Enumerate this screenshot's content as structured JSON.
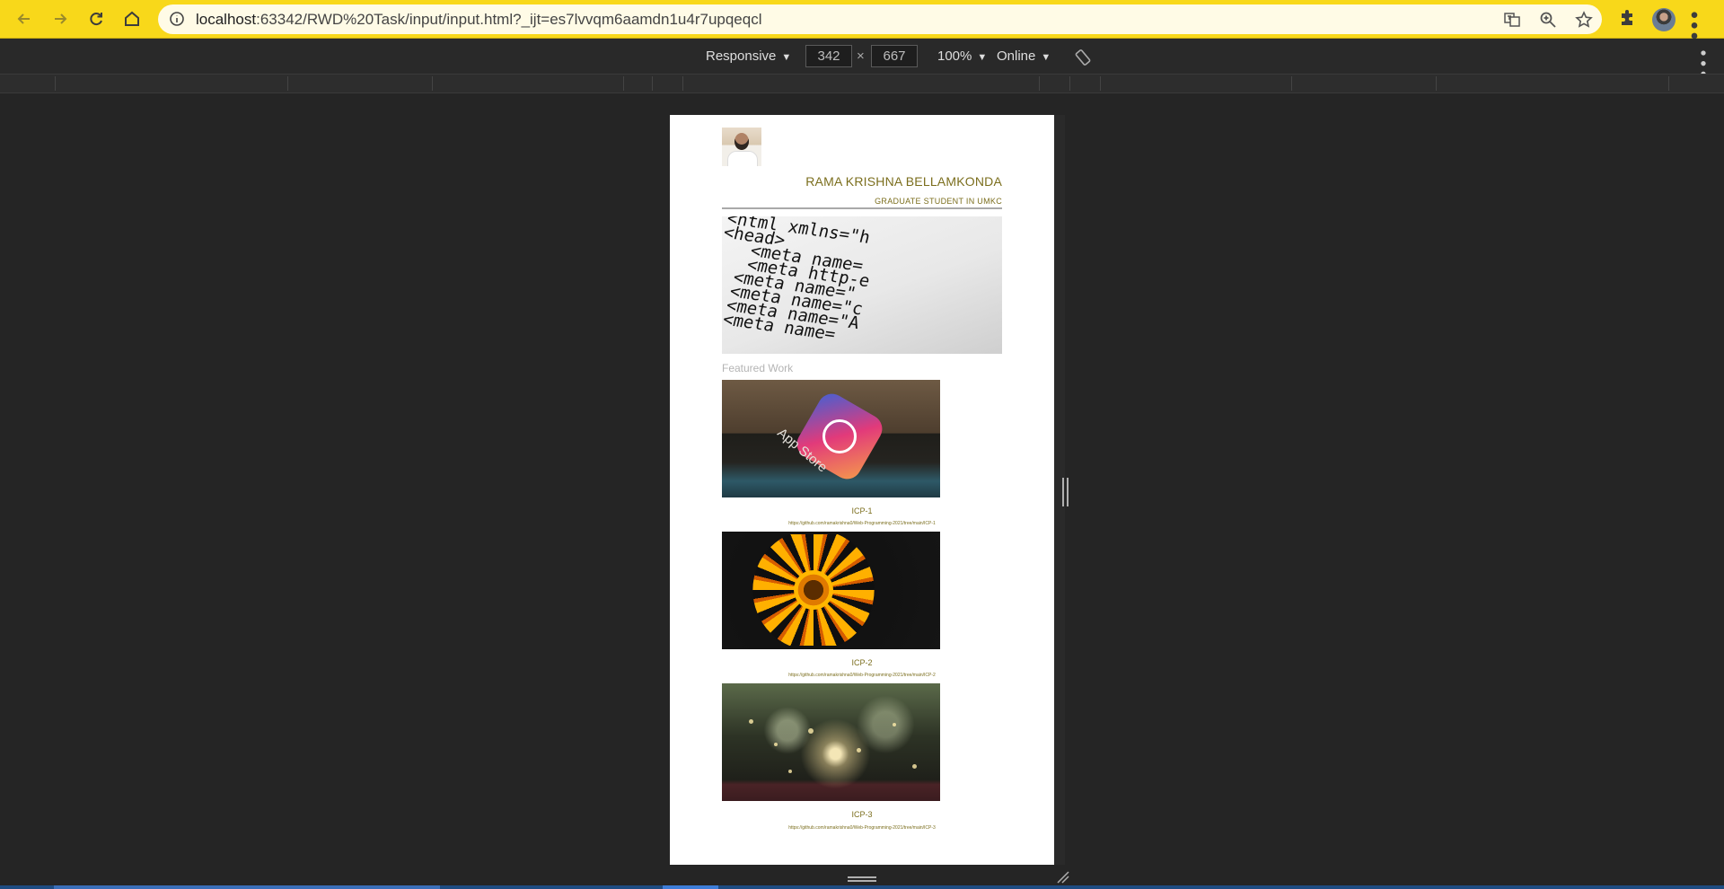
{
  "browser": {
    "url_host": "localhost",
    "url_rest": ":63342/RWD%20Task/input/input.html?_ijt=es7lvvqm6aamdn1u4r7upqeqcl",
    "icons": [
      "back-arrow-icon",
      "forward-arrow-icon",
      "reload-icon",
      "home-icon",
      "site-info-icon",
      "translate-icon",
      "zoom-icon",
      "bookmark-star-icon",
      "extensions-puzzle-icon",
      "profile-avatar",
      "browser-menu-icon"
    ]
  },
  "devtools": {
    "device": "Responsive",
    "width": "342",
    "times": "×",
    "height": "667",
    "zoom": "100%",
    "network": "Online"
  },
  "page": {
    "name": "RAMA KRISHNA BELLAMKONDA",
    "subtitle": "GRADUATE STUDENT IN UMKC",
    "hero_code": "<html xmlns=\"h\n<head>\n   <meta name=\n   <meta http-e\n  <meta name=\"\n  <meta name=\"c\n  <meta name=\"A\n  <meta name=",
    "featured_heading": "Featured Work",
    "works": [
      {
        "title": "ICP-1",
        "link": "https://github.com/ramakrishna0/Web-Programming-2021/tree/main/ICP-1",
        "image_alt": "App Store"
      },
      {
        "title": "ICP-2",
        "link": "https://github.com/ramakrishna0/Web-Programming-2021/tree/main/ICP-2"
      },
      {
        "title": "ICP-3",
        "link": "https://github.com/ramakrishna0/Web-Programming-2021/tree/main/ICP-3"
      }
    ]
  },
  "colors": {
    "chrome_accent": "#f8d81a",
    "heading_olive": "#7b6e1d",
    "devtools_bg": "#252525"
  }
}
